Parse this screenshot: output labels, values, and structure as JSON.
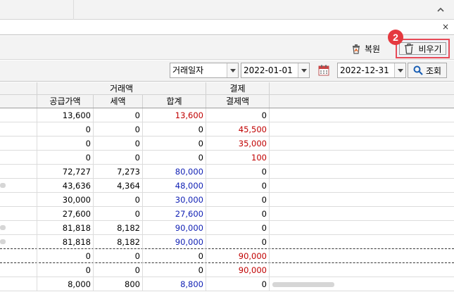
{
  "window": {
    "collapse_icon": "chevron-up-icon",
    "close_glyph": "×"
  },
  "toolbar": {
    "restore_label": "복원",
    "restore_icon": "restore-trash-icon",
    "empty_label": "비우기",
    "empty_icon": "trash-icon",
    "step_badge": "2",
    "highlight_color": "#e74a57",
    "badge_color": "#e5393f"
  },
  "filter": {
    "date_type_value": "거래일자",
    "date_from": "2022-01-01",
    "date_to": "2022-12-31",
    "calendar_icon": "calendar-icon",
    "search_label": "조회",
    "search_icon": "search-icon"
  },
  "grid": {
    "group_headers": {
      "amount": "거래액",
      "payment": "결제"
    },
    "columns": [
      "공급가액",
      "세액",
      "합계",
      "결제액"
    ],
    "rows": [
      {
        "supply": "13,600",
        "tax": "0",
        "total": "13,600",
        "total_color": "red",
        "paid": "0",
        "paid_color": "black",
        "left_blur": false,
        "memo_blur": false
      },
      {
        "supply": "0",
        "tax": "0",
        "total": "0",
        "total_color": "black",
        "paid": "45,500",
        "paid_color": "red",
        "left_blur": false,
        "memo_blur": false
      },
      {
        "supply": "0",
        "tax": "0",
        "total": "0",
        "total_color": "black",
        "paid": "35,000",
        "paid_color": "red",
        "left_blur": false,
        "memo_blur": false
      },
      {
        "supply": "0",
        "tax": "0",
        "total": "0",
        "total_color": "black",
        "paid": "100",
        "paid_color": "red",
        "left_blur": false,
        "memo_blur": false
      },
      {
        "supply": "72,727",
        "tax": "7,273",
        "total": "80,000",
        "total_color": "blue",
        "paid": "0",
        "paid_color": "black",
        "left_blur": false,
        "memo_blur": false
      },
      {
        "supply": "43,636",
        "tax": "4,364",
        "total": "48,000",
        "total_color": "blue",
        "paid": "0",
        "paid_color": "black",
        "left_blur": true,
        "memo_blur": false
      },
      {
        "supply": "30,000",
        "tax": "0",
        "total": "30,000",
        "total_color": "blue",
        "paid": "0",
        "paid_color": "black",
        "left_blur": false,
        "memo_blur": false
      },
      {
        "supply": "27,600",
        "tax": "0",
        "total": "27,600",
        "total_color": "blue",
        "paid": "0",
        "paid_color": "black",
        "left_blur": false,
        "memo_blur": false
      },
      {
        "supply": "81,818",
        "tax": "8,182",
        "total": "90,000",
        "total_color": "blue",
        "paid": "0",
        "paid_color": "black",
        "left_blur": true,
        "memo_blur": false
      },
      {
        "supply": "81,818",
        "tax": "8,182",
        "total": "90,000",
        "total_color": "blue",
        "paid": "0",
        "paid_color": "black",
        "left_blur": true,
        "memo_blur": false
      },
      {
        "supply": "0",
        "tax": "0",
        "total": "0",
        "total_color": "black",
        "paid": "90,000",
        "paid_color": "red",
        "left_blur": false,
        "memo_blur": false
      },
      {
        "supply": "0",
        "tax": "0",
        "total": "0",
        "total_color": "black",
        "paid": "90,000",
        "paid_color": "red",
        "left_blur": false,
        "memo_blur": false
      },
      {
        "supply": "8,000",
        "tax": "800",
        "total": "8,800",
        "total_color": "blue",
        "paid": "0",
        "paid_color": "black",
        "left_blur": false,
        "memo_blur": true
      }
    ]
  }
}
